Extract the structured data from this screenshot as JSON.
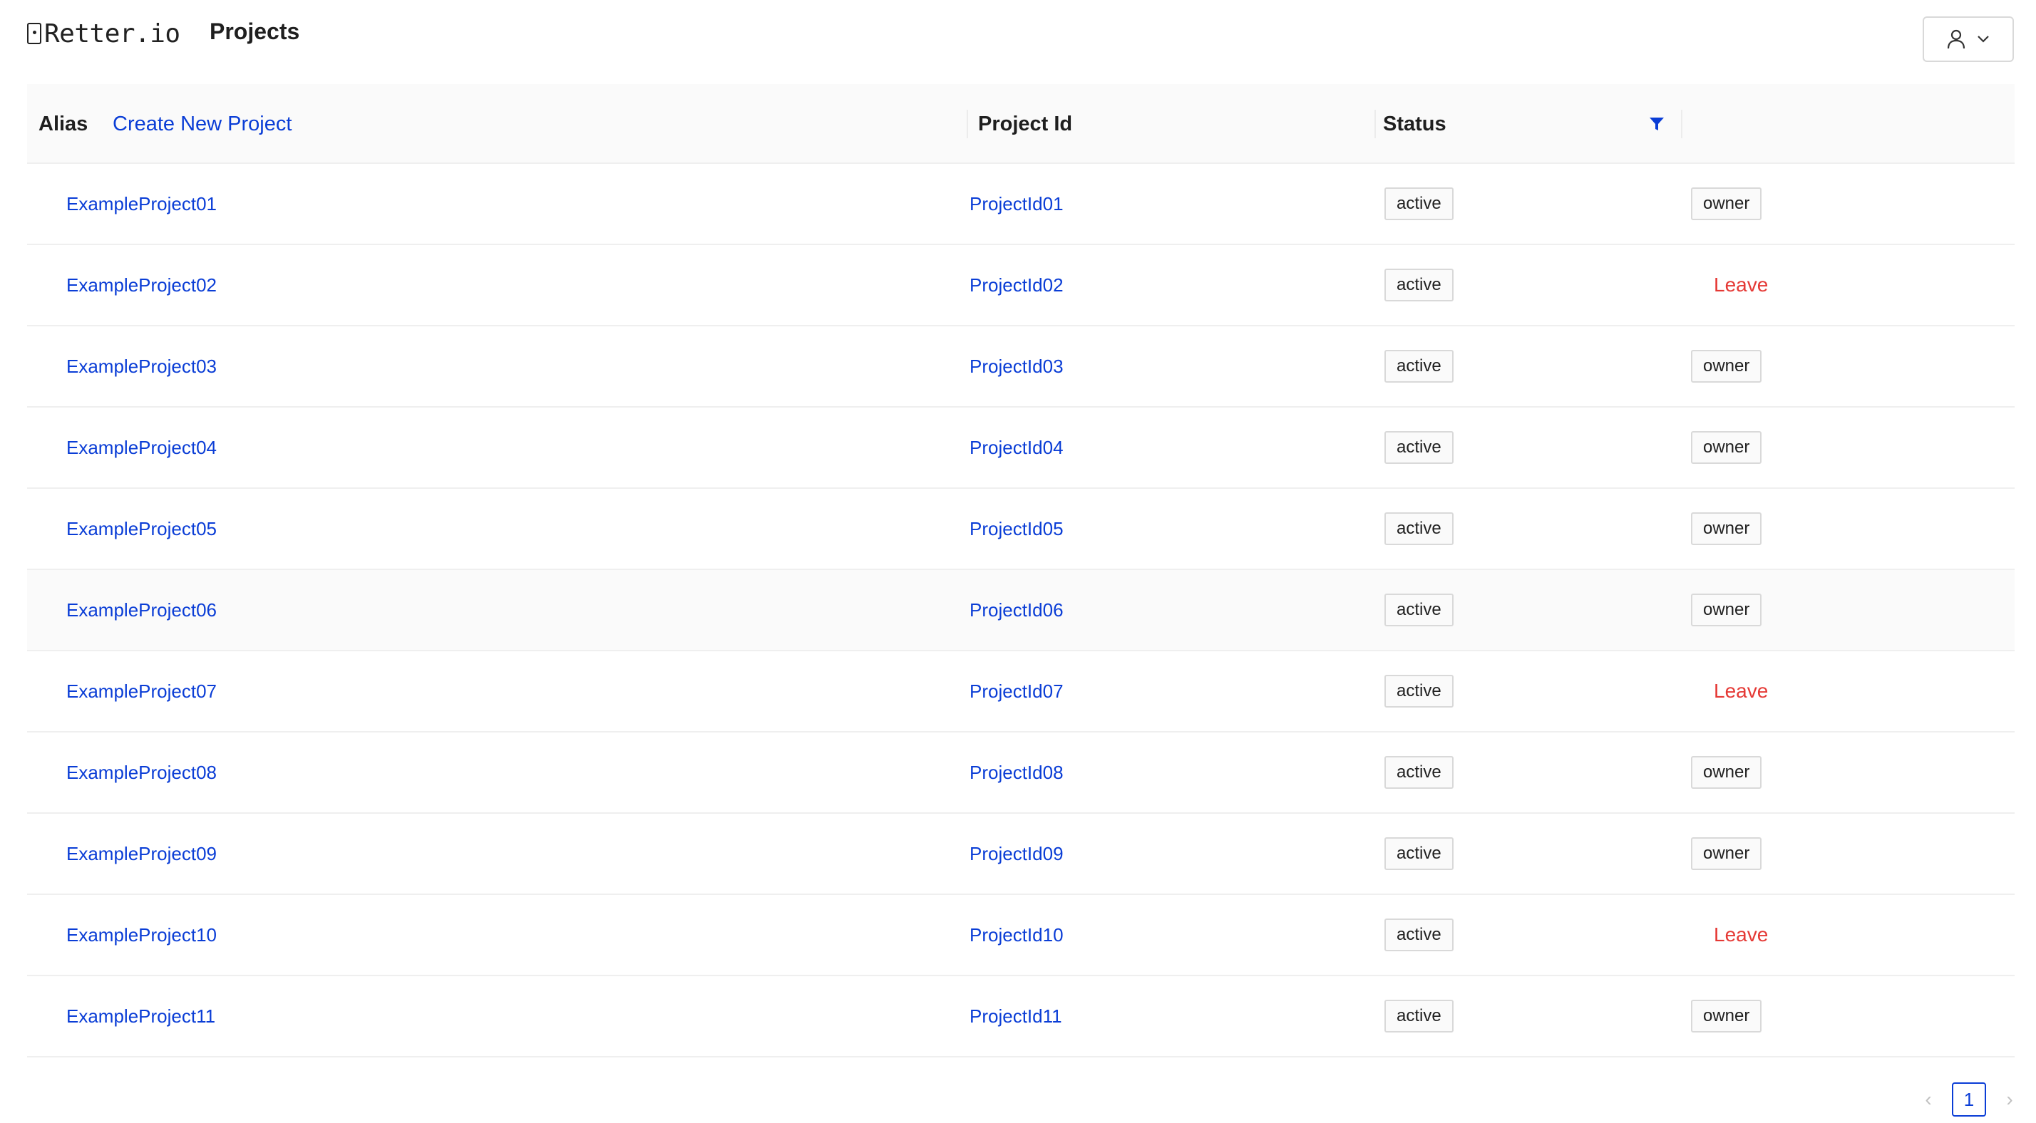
{
  "header": {
    "logo_text": "Retter.io",
    "page_title": "Projects",
    "user_icon": "user-icon",
    "chevron_icon": "chevron-down-icon"
  },
  "table": {
    "columns": {
      "alias": "Alias",
      "create_link": "Create New Project",
      "project_id": "Project Id",
      "status": "Status"
    },
    "filter_icon": "filter-icon",
    "rows": [
      {
        "alias": "ExampleProject01",
        "project_id": "ProjectId01",
        "status": "active",
        "action": "owner"
      },
      {
        "alias": "ExampleProject02",
        "project_id": "ProjectId02",
        "status": "active",
        "action": "Leave"
      },
      {
        "alias": "ExampleProject03",
        "project_id": "ProjectId03",
        "status": "active",
        "action": "owner"
      },
      {
        "alias": "ExampleProject04",
        "project_id": "ProjectId04",
        "status": "active",
        "action": "owner"
      },
      {
        "alias": "ExampleProject05",
        "project_id": "ProjectId05",
        "status": "active",
        "action": "owner"
      },
      {
        "alias": "ExampleProject06",
        "project_id": "ProjectId06",
        "status": "active",
        "action": "owner"
      },
      {
        "alias": "ExampleProject07",
        "project_id": "ProjectId07",
        "status": "active",
        "action": "Leave"
      },
      {
        "alias": "ExampleProject08",
        "project_id": "ProjectId08",
        "status": "active",
        "action": "owner"
      },
      {
        "alias": "ExampleProject09",
        "project_id": "ProjectId09",
        "status": "active",
        "action": "owner"
      },
      {
        "alias": "ExampleProject10",
        "project_id": "ProjectId10",
        "status": "active",
        "action": "Leave"
      },
      {
        "alias": "ExampleProject11",
        "project_id": "ProjectId11",
        "status": "active",
        "action": "owner"
      }
    ]
  },
  "pagination": {
    "prev_icon": "chevron-left-icon",
    "current_page": "1",
    "next_icon": "chevron-right-icon"
  },
  "colors": {
    "link": "#0a3dd6",
    "danger": "#e53935",
    "header_bg": "#fafafa",
    "border": "#d9d9d9"
  }
}
